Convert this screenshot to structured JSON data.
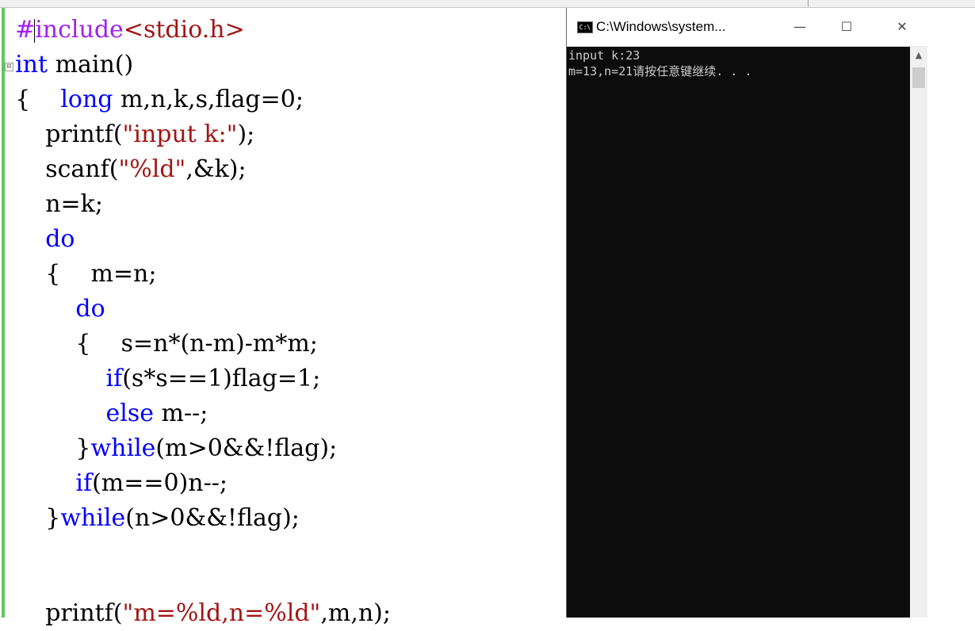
{
  "console": {
    "title": "C:\\Windows\\system...",
    "icon": "cmd-icon",
    "icon_glyph": "C:\\",
    "minimize_glyph": "—",
    "maximize_glyph": "☐",
    "close_glyph": "✕",
    "scroll_up_glyph": "▲",
    "lines": [
      "input k:23",
      "m=13,n=21请按任意键继续. . ."
    ]
  },
  "editor": {
    "fold_glyph": "⊟",
    "code": {
      "l1": {
        "pre": "#include",
        "post": "<stdio.h>"
      },
      "l2": {
        "kw": "int",
        "rest": " main()"
      },
      "l3": {
        "pre": "{    ",
        "kw": "long",
        "rest": " m,n,k,s,flag=0;"
      },
      "l4": {
        "pre": "    printf(",
        "str": "\"input k:\"",
        "rest": ");"
      },
      "l5": {
        "pre": "    scanf(",
        "str": "\"%ld\"",
        "rest": ",&k);"
      },
      "l6": {
        "text": "    n=k;"
      },
      "l7": {
        "kw": "do"
      },
      "l8": {
        "text": "    {    m=n;"
      },
      "l9": {
        "kw": "do"
      },
      "l10": {
        "text": "        {    s=n*(n-m)-m*m;"
      },
      "l11": {
        "kw": "if",
        "rest": "(s*s==1)flag=1;"
      },
      "l12": {
        "kw": "else",
        "rest": " m--;"
      },
      "l13": {
        "pre": "        }",
        "kw": "while",
        "rest": "(m>0&&!flag);"
      },
      "l14": {
        "kw": "if",
        "rest": "(m==0)n--;"
      },
      "l15": {
        "pre": "    }",
        "kw": "while",
        "rest": "(n>0&&!flag);"
      },
      "l16": {
        "pre": "    printf(",
        "str": "\"m=%ld,n=%ld\"",
        "rest": ",m,n);"
      }
    }
  }
}
